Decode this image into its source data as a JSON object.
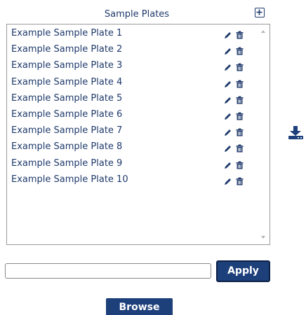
{
  "panel": {
    "title": "Sample Plates",
    "add_icon": "plus-square-icon",
    "items": [
      {
        "label": "Example Sample Plate 1"
      },
      {
        "label": "Example Sample Plate 2"
      },
      {
        "label": "Example Sample Plate 3"
      },
      {
        "label": "Example Sample Plate 4"
      },
      {
        "label": "Example Sample Plate 5"
      },
      {
        "label": "Example Sample Plate 6"
      },
      {
        "label": "Example Sample Plate 7"
      },
      {
        "label": "Example Sample Plate 8"
      },
      {
        "label": "Example Sample Plate 9"
      },
      {
        "label": "Example Sample Plate 10"
      }
    ],
    "row_icons": [
      "pencil-icon",
      "trash-icon"
    ]
  },
  "download": {
    "icon": "download-icon"
  },
  "filter": {
    "value": "",
    "placeholder": ""
  },
  "buttons": {
    "apply_label": "Apply",
    "browse_label": "Browse"
  },
  "colors": {
    "text": "#1f3a6b",
    "button_bg": "#1d3f7a",
    "button_text": "#ffffff"
  }
}
